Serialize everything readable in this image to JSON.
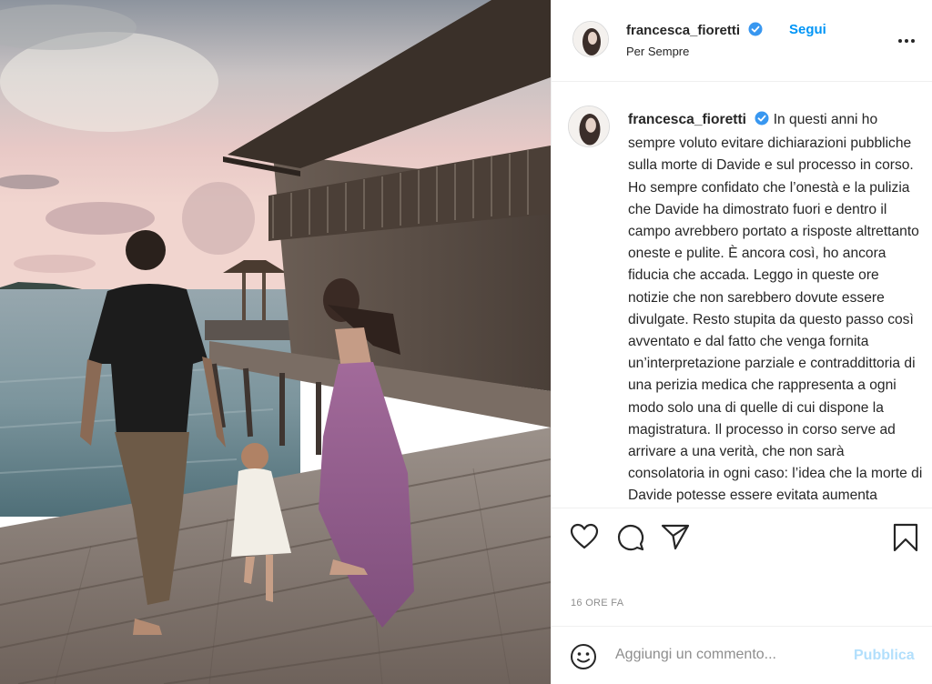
{
  "post": {
    "username": "francesca_fioretti",
    "follow_label": "Segui",
    "location": "Per Sempre",
    "caption_text": "In questi anni ho sempre voluto evitare dichiarazioni pubbliche sulla morte di Davide e sul processo in corso. Ho sempre confidato che l’onestà e la pulizia che Davide ha dimostrato fuori e dentro il campo avrebbero portato a risposte altrettanto oneste e pulite. È ancora così, ho ancora fiducia che accada. Leggo in queste ore notizie che non sarebbero dovute essere divulgate. Resto stupita da questo passo così avventato e dal fatto che venga fornita un’interpretazione parziale e contraddittoria di una perizia medica che rappresenta a ogni modo solo una di quelle di cui dispone la magistratura. Il processo in corso serve ad arrivare a una verità, che non sarà consolatoria in ogni caso: l’idea che la morte di Davide potesse essere evitata aumenta persino il dolore",
    "timestamp": "16 ORE FA"
  },
  "comment": {
    "placeholder": "Aggiungi un commento...",
    "publish_label": "Pubblica"
  },
  "icons": {
    "verified": "verified-badge-icon",
    "more": "more-options-icon",
    "like": "heart-icon",
    "comment": "comment-bubble-icon",
    "share": "paper-plane-icon",
    "save": "bookmark-icon",
    "emoji": "emoji-icon"
  },
  "colors": {
    "accent": "#0095f6",
    "publish_disabled": "#b2dffc",
    "muted": "#8e8e8e",
    "text": "#262626"
  }
}
